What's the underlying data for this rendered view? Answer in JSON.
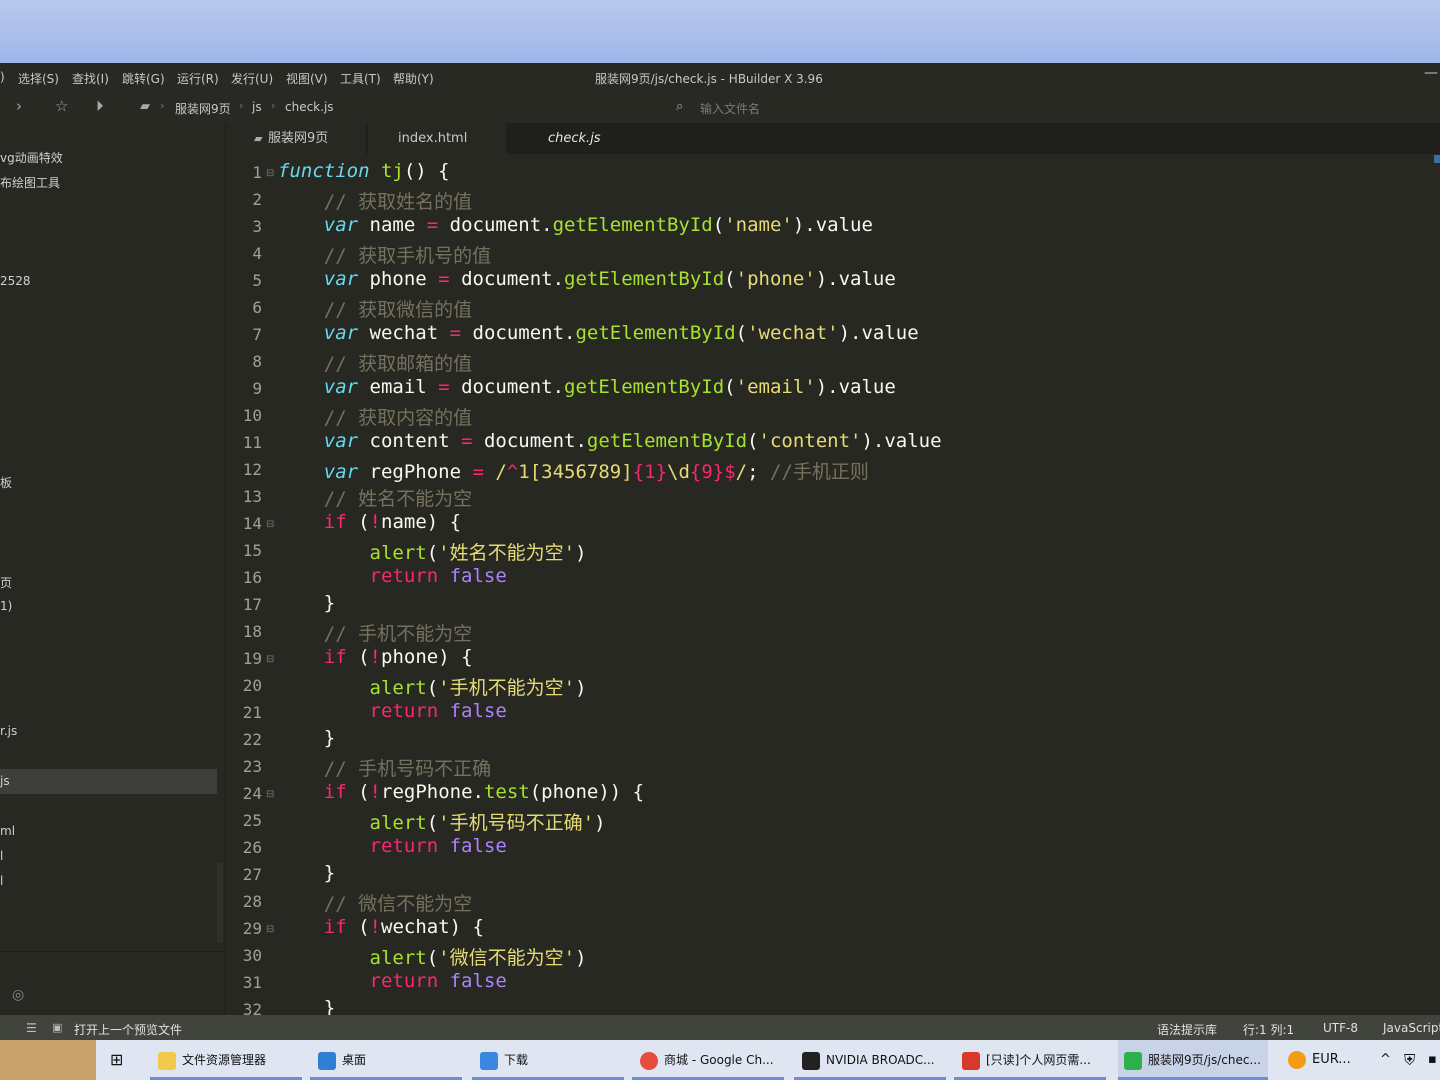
{
  "window": {
    "title": "服装网9页/js/check.js - HBuilder X 3.96"
  },
  "menu": [
    "选择(S)",
    "查找(I)",
    "跳转(G)",
    "运行(R)",
    "发行(U)",
    "视图(V)",
    "工具(T)",
    "帮助(Y)"
  ],
  "menu_fragment": ")",
  "toolbar": {
    "breadcrumb": [
      "服装网9页",
      "js",
      "check.js"
    ],
    "file_search_placeholder": "输入文件名"
  },
  "sidebar": {
    "items": [
      "vg动画特效",
      "布绘图工具",
      "2528",
      "板",
      "页",
      "1)",
      "r.js",
      "js",
      "ml",
      "l",
      "l"
    ]
  },
  "tabs": [
    "服装网9页",
    "index.html",
    "check.js"
  ],
  "editor": {
    "line_numbers": [
      "1",
      "2",
      "3",
      "4",
      "5",
      "6",
      "7",
      "8",
      "9",
      "10",
      "11",
      "12",
      "13",
      "14",
      "15",
      "16",
      "17",
      "18",
      "19",
      "20",
      "21",
      "22",
      "23",
      "24",
      "25",
      "26",
      "27",
      "28",
      "29",
      "30",
      "31",
      "32"
    ],
    "comments": {
      "c2": "// 获取姓名的值",
      "c4": "// 获取手机号的值",
      "c6": "// 获取微信的值",
      "c8": "// 获取邮箱的值",
      "c10": "// 获取内容的值",
      "c12": "//手机正则",
      "c13": "// 姓名不能为空",
      "c18": "// 手机不能为空",
      "c23": "// 手机号码不正确",
      "c28": "// 微信不能为空"
    },
    "strings": {
      "s3": "'name'",
      "s5": "'phone'",
      "s7": "'wechat'",
      "s9": "'email'",
      "s11": "'content'",
      "a15": "'姓名不能为空'",
      "a20": "'手机不能为空'",
      "a25": "'手机号码不正确'",
      "a30": "'微信不能为空'"
    }
  },
  "statusbar": {
    "preview": "打开上一个预览文件",
    "syntax": "语法提示库",
    "position": "行:1  列:1",
    "encoding": "UTF-8",
    "language": "JavaScript"
  },
  "taskbar": {
    "items": [
      "文件资源管理器",
      "桌面",
      "下载",
      "商城 - Google Ch...",
      "NVIDIA BROADC...",
      "[只读]个人网页需...",
      "服装网9页/js/chec...",
      "EUR..."
    ]
  },
  "colors": {
    "editor_bg": "#272822",
    "keyword": "#66d9ef",
    "control": "#f92672",
    "function": "#a6e22e",
    "string": "#e6db74",
    "boolean": "#ae81ff",
    "comment": "#75715e"
  }
}
